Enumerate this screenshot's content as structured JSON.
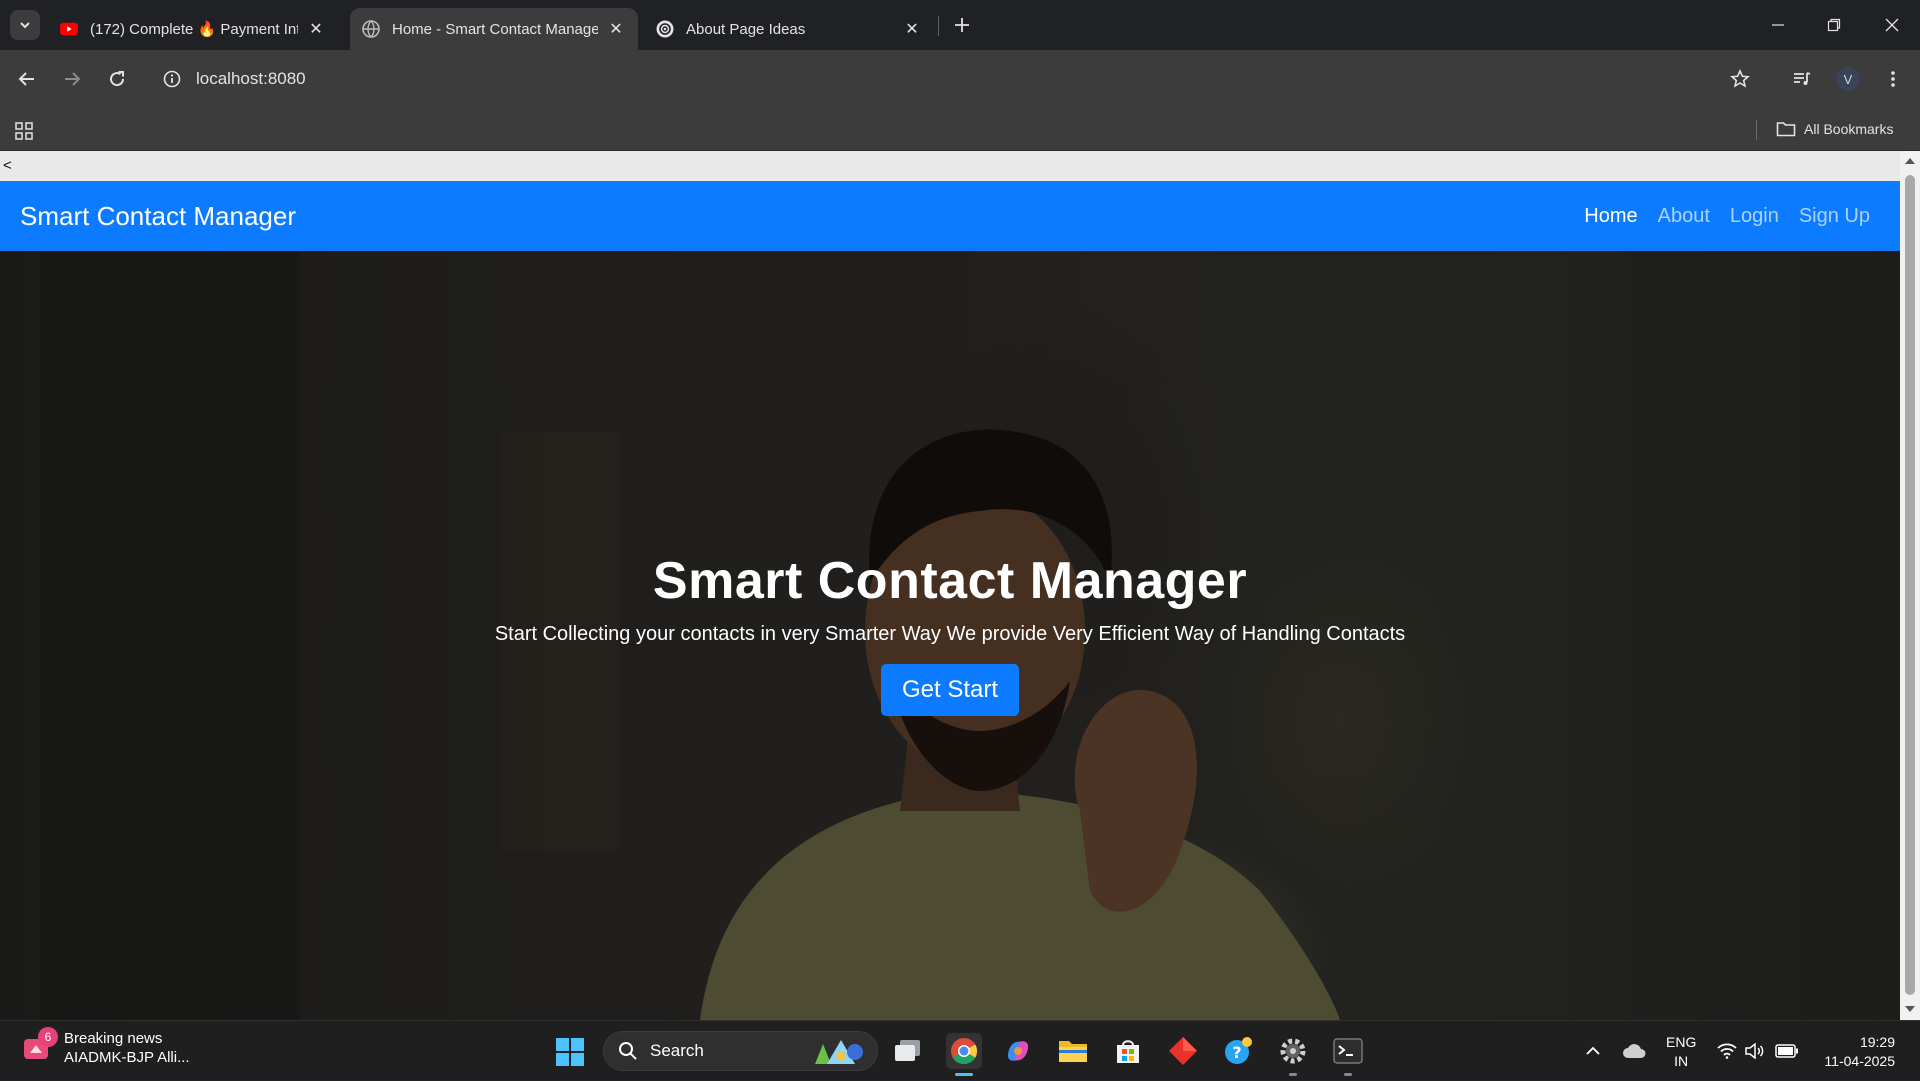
{
  "browser": {
    "tabs": [
      {
        "title": "(172) Complete 🔥 Payment Int",
        "icon": "youtube-icon",
        "active": false
      },
      {
        "title": "Home - Smart Contact Manage",
        "icon": "globe-icon",
        "active": true
      },
      {
        "title": "About Page Ideas",
        "icon": "chatgpt-icon",
        "active": false
      }
    ],
    "url": "localhost:8080",
    "profile_initial": "V",
    "all_bookmarks": "All Bookmarks"
  },
  "page": {
    "back_link": "<",
    "navbar": {
      "brand": "Smart Contact Manager",
      "links": [
        "Home",
        "About",
        "Login",
        "Sign Up"
      ],
      "active": "Home"
    },
    "hero": {
      "title": "Smart Contact Manager",
      "subtitle": "Start Collecting your contacts in very Smarter Way We provide Very Efficient Way of Handling Contacts",
      "button": "Get Start"
    },
    "colors": {
      "primary": "#0d7bff",
      "navbar_text_muted": "rgba(255,255,255,0.65)"
    }
  },
  "taskbar": {
    "news": {
      "title": "Breaking news",
      "headline": "AIADMK-BJP Alli...",
      "badge": "6"
    },
    "search_label": "Search",
    "language": {
      "line1": "ENG",
      "line2": "IN"
    },
    "clock": {
      "time": "19:29",
      "date": "11-04-2025"
    }
  }
}
